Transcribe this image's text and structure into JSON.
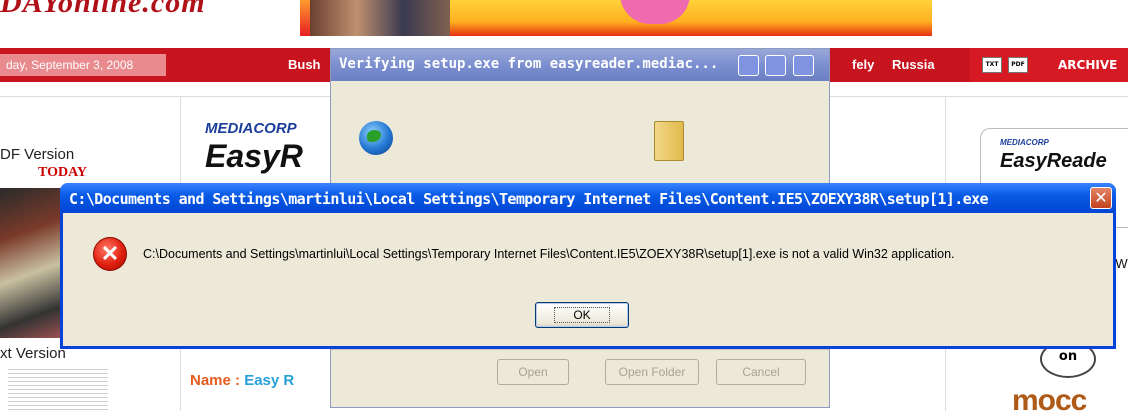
{
  "page": {
    "logo": "DAYonline.com",
    "date": "day, September 3, 2008",
    "nav_links": [
      "Bush",
      "fely",
      "Russia"
    ],
    "nav_right": {
      "txt_icon": "TXT",
      "pdf_icon": "PDF",
      "archive": "ARCHIVE"
    },
    "pdf_version": "DF Version",
    "today_logo": "TODAY",
    "text_version": "xt Version",
    "mediacorp": "MEDIACORP",
    "easy": "EasyR",
    "name_label": "Name :",
    "name_value": "Easy R",
    "side_mediacorp": "MEDIACORP",
    "side_easy": "EasyReade",
    "frag1": "!",
    "frag2": "DW",
    "on_badge": "on",
    "moc": "mocc"
  },
  "verify_dialog": {
    "title": "Verifying setup.exe from easyreader.mediac...",
    "buttons": {
      "open": "Open",
      "open_folder": "Open Folder",
      "cancel": "Cancel"
    }
  },
  "error_dialog": {
    "title": "C:\\Documents and Settings\\martinlui\\Local Settings\\Temporary Internet Files\\Content.IE5\\ZOEXY38R\\setup[1].exe",
    "message": "C:\\Documents and Settings\\martinlui\\Local Settings\\Temporary Internet Files\\Content.IE5\\ZOEXY38R\\setup[1].exe is not a valid Win32 application.",
    "ok_label": "OK",
    "close_glyph": "✕",
    "error_glyph": "✕"
  }
}
